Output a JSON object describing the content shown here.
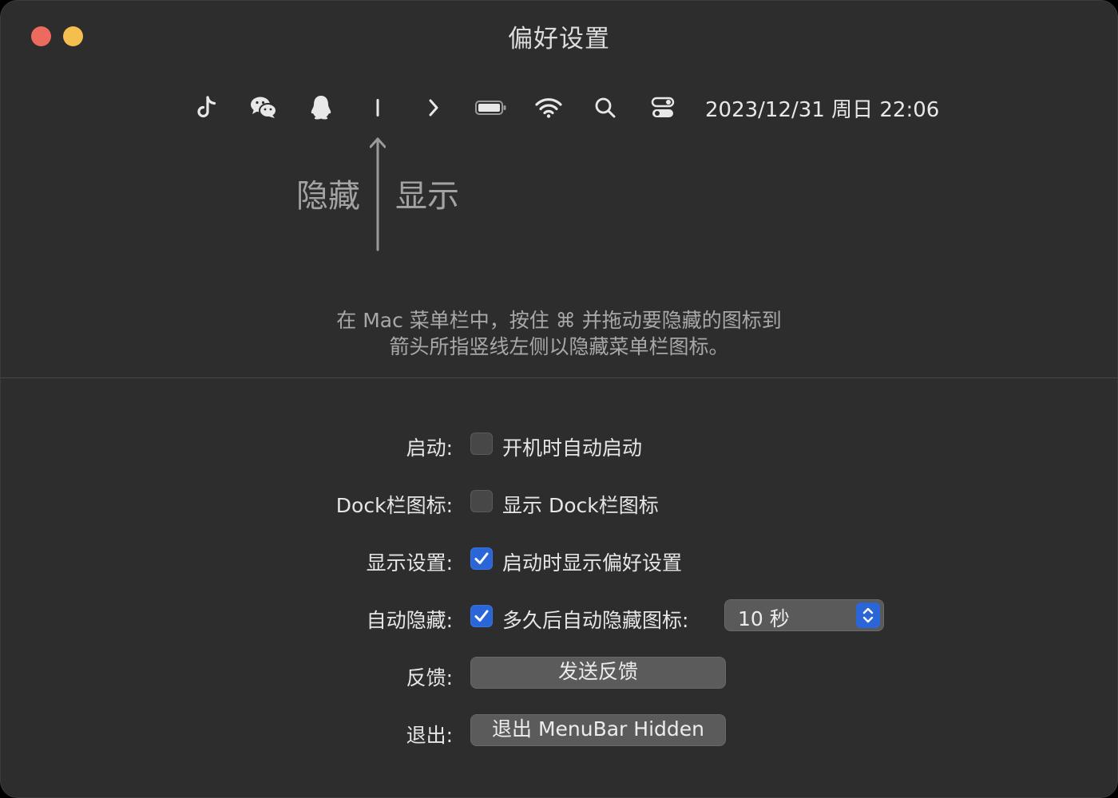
{
  "window": {
    "title": "偏好设置",
    "controls": [
      "close",
      "minimize"
    ]
  },
  "menubar_preview": {
    "icons": [
      {
        "name": "tiktok-icon"
      },
      {
        "name": "wechat-icon"
      },
      {
        "name": "qq-icon"
      },
      {
        "name": "separator-line-icon"
      },
      {
        "name": "chevron-right-icon"
      },
      {
        "name": "battery-icon"
      },
      {
        "name": "wifi-icon"
      },
      {
        "name": "search-icon"
      },
      {
        "name": "control-center-icon"
      }
    ],
    "datetime": "2023/12/31 周日 22:06"
  },
  "guide": {
    "hide_label": "隐藏",
    "show_label": "显示",
    "instruction_line1": "在 Mac 菜单栏中，按住 ⌘ 并拖动要隐藏的图标到",
    "instruction_line2": "箭头所指竖线左侧以隐藏菜单栏图标。"
  },
  "settings": {
    "startup": {
      "label": "启动:",
      "checkbox_text": "开机时自动启动",
      "checked": false
    },
    "dock_icon": {
      "label": "Dock栏图标:",
      "checkbox_text": "显示 Dock栏图标",
      "checked": false
    },
    "show_settings": {
      "label": "显示设置:",
      "checkbox_text": "启动时显示偏好设置",
      "checked": true
    },
    "auto_hide": {
      "label": "自动隐藏:",
      "checkbox_text": "多久后自动隐藏图标:",
      "checked": true,
      "select_value": "10 秒"
    },
    "feedback": {
      "label": "反馈:",
      "button_label": "发送反馈"
    },
    "quit": {
      "label": "退出:",
      "button_label": "退出 MenuBar Hidden"
    }
  },
  "colors": {
    "accent": "#2b66d9",
    "close": "#ed6a5e",
    "minimize": "#f5bf4f",
    "window_bg": "#2d2d2d"
  }
}
